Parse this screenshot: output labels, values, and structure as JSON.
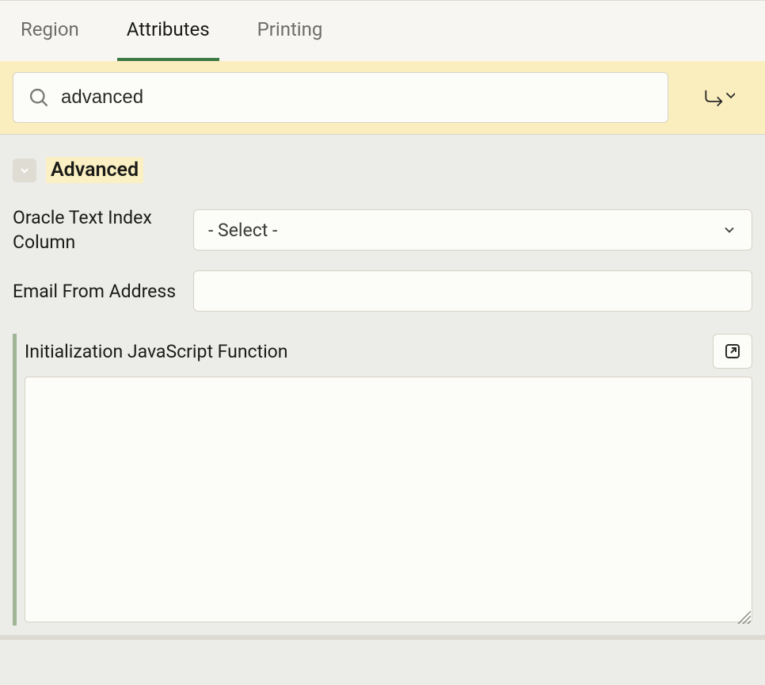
{
  "tabs": {
    "region": "Region",
    "attributes": "Attributes",
    "printing": "Printing"
  },
  "search": {
    "value": "advanced"
  },
  "section": {
    "title": "Advanced"
  },
  "fields": {
    "oracle_text_index_column": {
      "label": "Oracle Text Index Column",
      "selected": "- Select -"
    },
    "email_from_address": {
      "label": "Email From Address",
      "value": ""
    },
    "init_js_function": {
      "label": "Initialization JavaScript Function",
      "value": ""
    }
  }
}
